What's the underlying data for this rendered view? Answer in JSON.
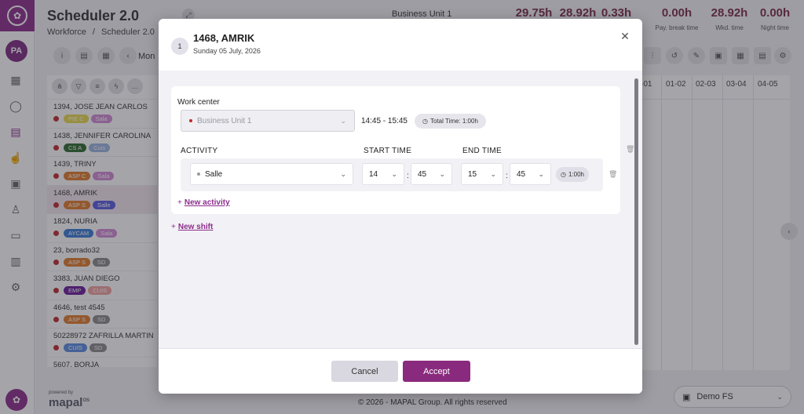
{
  "header": {
    "title": "Scheduler 2.0",
    "breadcrumb": [
      "Workforce",
      "Scheduler 2.0"
    ],
    "business_unit": "Business Unit 1",
    "stats": [
      {
        "value": "29.75h",
        "label": ""
      },
      {
        "value": "28.92h",
        "label": ""
      },
      {
        "value": "0.33h",
        "label": ""
      },
      {
        "value": "0.00h",
        "label": "Pay. break time"
      },
      {
        "value": "28.92h",
        "label": "Wkd. time"
      },
      {
        "value": "0.00h",
        "label": "Night time"
      }
    ]
  },
  "toolbar": {
    "period_label": "Mon"
  },
  "rail": {
    "avatar_initials": "PA"
  },
  "employees": [
    {
      "name": "1394, JOSE JEAN CARLOS",
      "tags": [
        {
          "label": "PIE C",
          "color": "#e8d84a"
        },
        {
          "label": "Sala",
          "color": "#d38ad6"
        }
      ]
    },
    {
      "name": "1438, JENNIFER CAROLINA",
      "tags": [
        {
          "label": "CS A",
          "color": "#2f6a2f"
        },
        {
          "label": "Cuis",
          "color": "#9bb3e0"
        }
      ]
    },
    {
      "name": "1439, TRINY",
      "tags": [
        {
          "label": "ASP C",
          "color": "#e07b2a"
        },
        {
          "label": "Sala",
          "color": "#d38ad6"
        }
      ]
    },
    {
      "name": "1468, AMRIK",
      "tags": [
        {
          "label": "ASP S",
          "color": "#e07b2a"
        },
        {
          "label": "Salle",
          "color": "#5a5ae0"
        }
      ]
    },
    {
      "name": "1824, NURIA",
      "tags": [
        {
          "label": "AYCAM",
          "color": "#3a7ad6"
        },
        {
          "label": "Sala",
          "color": "#d38ad6"
        }
      ]
    },
    {
      "name": "23, borrado32",
      "tags": [
        {
          "label": "ASP S",
          "color": "#e07b2a"
        },
        {
          "label": "SD",
          "color": "#8a8a8a"
        }
      ]
    },
    {
      "name": "3383, JUAN DIEGO",
      "tags": [
        {
          "label": "EMP",
          "color": "#6a1a9a"
        },
        {
          "label": "CUIS",
          "color": "#f0a0a0"
        }
      ]
    },
    {
      "name": "4646, test 4545",
      "tags": [
        {
          "label": "ASP S",
          "color": "#e07b2a"
        },
        {
          "label": "SD",
          "color": "#8a8a8a"
        }
      ]
    },
    {
      "name": "50228972 ZAFRILLA MARTIN",
      "tags": [
        {
          "label": "CUIS",
          "color": "#5a8ae0"
        },
        {
          "label": "SD",
          "color": "#8a8a8a"
        }
      ]
    },
    {
      "name": "5607, BORJA",
      "tags": []
    }
  ],
  "grid": {
    "columns": [
      "-01",
      "01-02",
      "02-03",
      "03-04",
      "04-05"
    ]
  },
  "footer": {
    "copyright": "© 2026 - MAPAL Group. All rights reserved",
    "powered_by": "powered by",
    "brand": "mapal",
    "brand_suffix": "OS",
    "account": "Demo FS"
  },
  "modal": {
    "badge": "1",
    "title": "1468, AMRIK",
    "subtitle": "Sunday 05 July, 2026",
    "work_center_label": "Work center",
    "work_center_value": "Business Unit 1",
    "shift_range": "14:45 - 15:45",
    "total_time": "Total Time: 1:00h",
    "col_activity": "ACTIVITY",
    "col_start": "START TIME",
    "col_end": "END TIME",
    "activity": "Salle",
    "start_hour": "14",
    "start_min": "45",
    "end_hour": "15",
    "end_min": "45",
    "duration": "1:00h",
    "new_activity": "New activity",
    "new_shift": "New shift",
    "cancel": "Cancel",
    "accept": "Accept"
  },
  "colors": {
    "brand": "#8c2d8c",
    "accept": "#8a2a7e",
    "stat": "#7a2a4a"
  }
}
